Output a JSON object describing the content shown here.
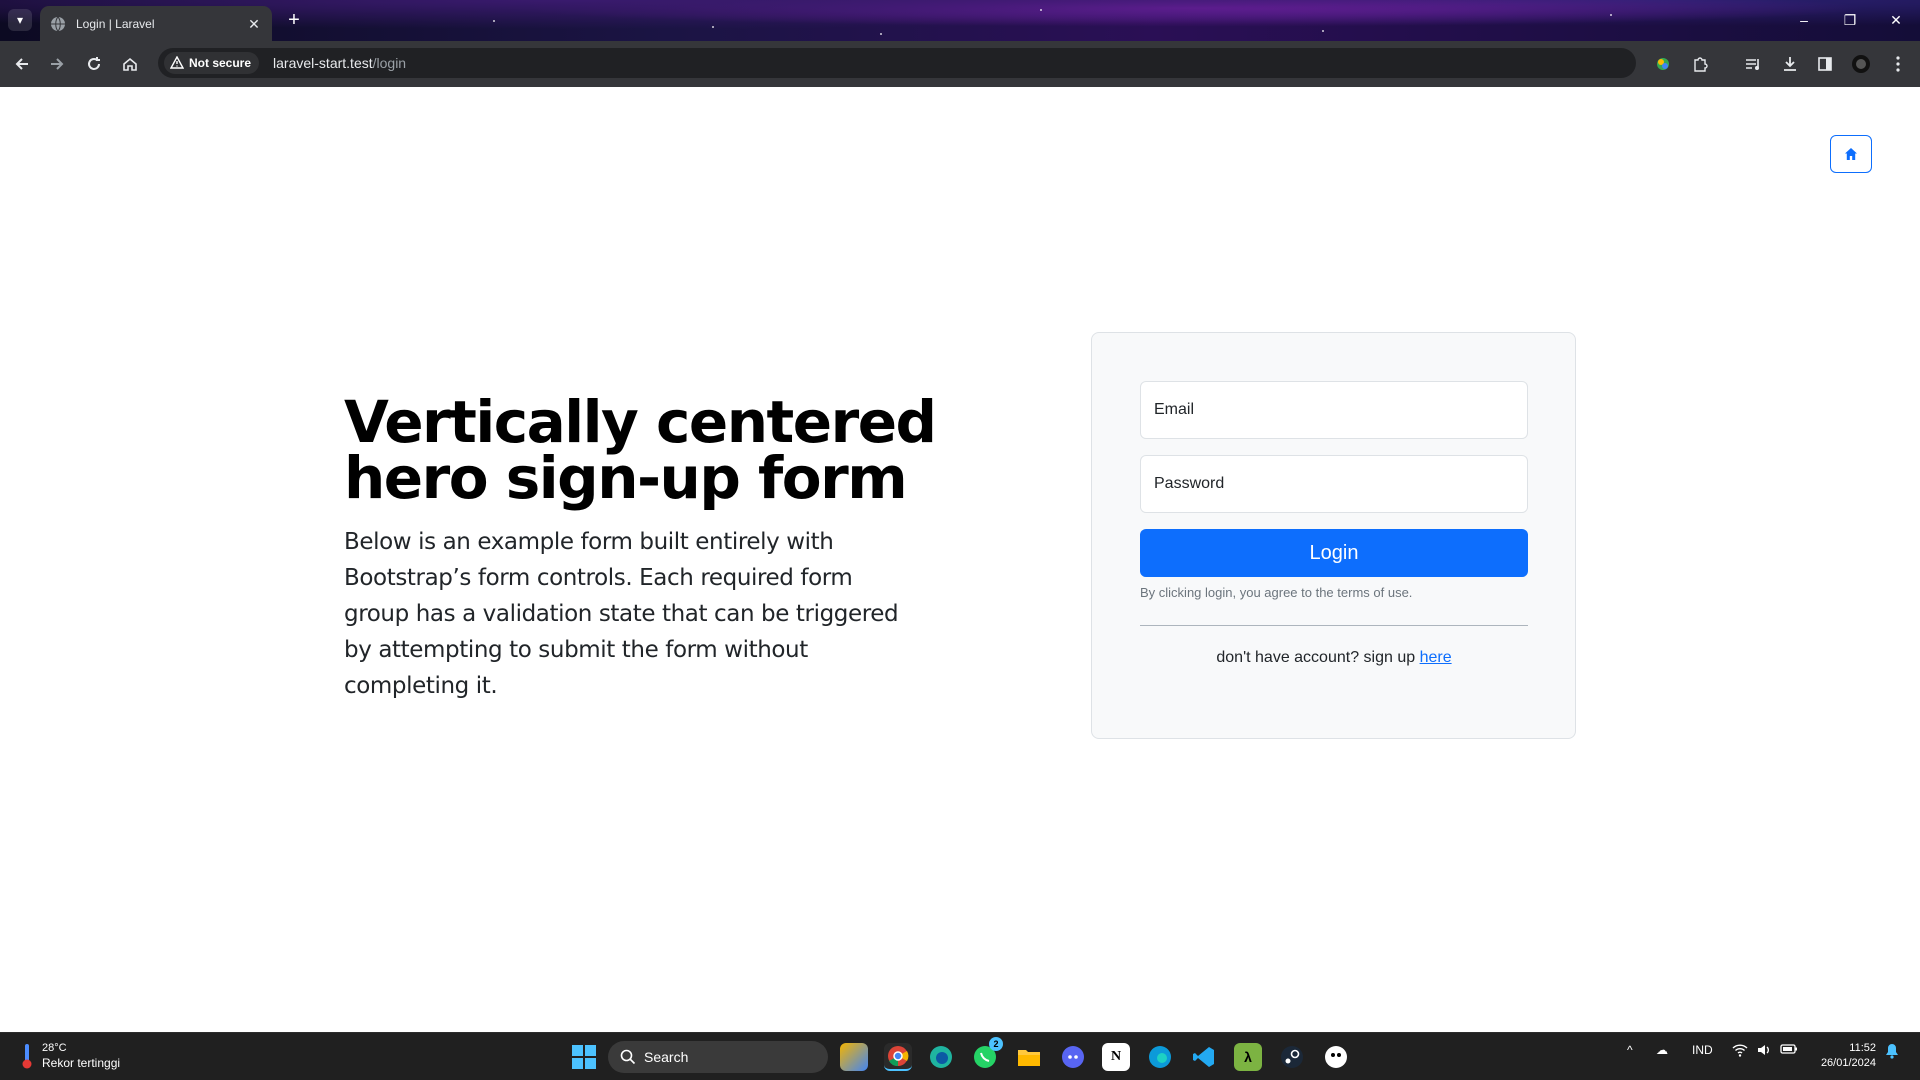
{
  "browser": {
    "tab_title": "Login | Laravel",
    "security_label": "Not secure",
    "url_host": "laravel-start.test",
    "url_path": "/login"
  },
  "hero": {
    "title": "Vertically centered hero sign-up form",
    "lead": "Below is an example form built entirely with Bootstrap’s form controls. Each required form group has a validation state that can be triggered by attempting to submit the form without completing it."
  },
  "form": {
    "email_placeholder": "Email",
    "password_placeholder": "Password",
    "login_label": "Login",
    "terms_text": "By clicking login, you agree to the terms of use.",
    "signup_prefix": "don't have account? sign up ",
    "signup_link": "here"
  },
  "taskbar": {
    "weather_temp": "28°C",
    "weather_desc": "Rekor tertinggi",
    "search_label": "Search",
    "whatsapp_badge": "2",
    "language": "IND",
    "time": "11:52",
    "date": "26/01/2024"
  },
  "colors": {
    "primary": "#0d6efd",
    "chrome_toolbar": "#35363a",
    "taskbar": "#202020"
  }
}
